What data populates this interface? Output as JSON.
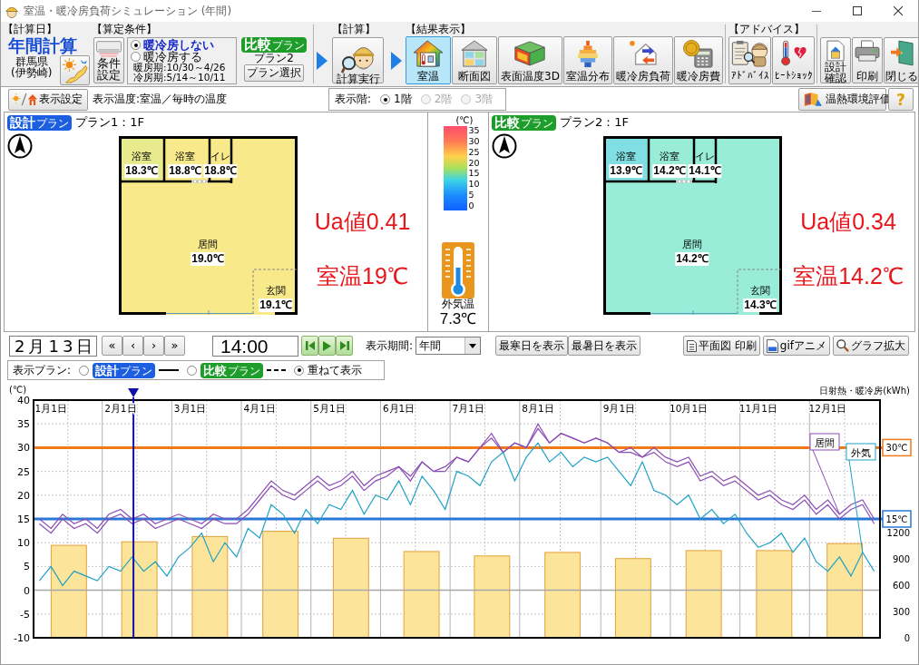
{
  "window": {
    "title": "室温・暖冷房負荷シミュレーション (年間)"
  },
  "toolbar": {
    "calc_date": {
      "heading": "【計算日】",
      "mode": "年間計算",
      "prefecture": "群馬県",
      "city": "(伊勢崎)"
    },
    "conditions": {
      "heading": "【算定条件】",
      "settings_button": "条件設定",
      "hvac_options": [
        {
          "label": "暖冷房しない",
          "selected": true
        },
        {
          "label": "暖冷房する",
          "selected": false
        }
      ],
      "heating_period": "暖房期:10/30～4/26",
      "cooling_period": "冷房期:5/14～10/11",
      "compare_badge": {
        "text": "比較",
        "suffix": "プラン",
        "color": "#1e9d2b"
      },
      "compare_plan": "プラン2",
      "plan_select_button": "プラン選択"
    },
    "calc": {
      "heading": "【計算】",
      "button": "計算実行"
    },
    "results": {
      "heading": "【結果表示】",
      "buttons": [
        {
          "kind": "room-temp",
          "label": "室温",
          "selected": true
        },
        {
          "kind": "section",
          "label": "断面図",
          "selected": false
        },
        {
          "kind": "surface-3d",
          "label": "表面温度3D",
          "selected": false
        },
        {
          "kind": "distribution",
          "label": "室温分布",
          "selected": false
        },
        {
          "kind": "load",
          "label": "暖冷房負荷",
          "selected": false
        },
        {
          "kind": "cost",
          "label": "暖冷房費",
          "selected": false
        }
      ]
    },
    "advice": {
      "heading": "【アドバイス】",
      "buttons": [
        {
          "kind": "advice",
          "label": "ｱﾄﾞﾊﾞｲｽ"
        },
        {
          "kind": "heat-shock",
          "label": "ﾋｰﾄｼｮｯｸ"
        }
      ]
    },
    "tools": [
      {
        "kind": "design-check",
        "label": "設計確認"
      },
      {
        "kind": "print",
        "label": "印刷"
      },
      {
        "kind": "close",
        "label": "閉じる"
      }
    ]
  },
  "display_bar": {
    "settings_button": "表示設定",
    "display_temp": "表示温度:室温／毎時の温度",
    "floor_label": "表示階:",
    "floors": [
      {
        "label": "1階",
        "selected": true,
        "disabled": false
      },
      {
        "label": "2階",
        "selected": false,
        "disabled": true
      },
      {
        "label": "3階",
        "selected": false,
        "disabled": true
      }
    ],
    "evaluation_button": "温熱環境評価",
    "help_button": "?"
  },
  "plans": [
    {
      "badge": {
        "text": "設計",
        "suffix": "プラン",
        "color": "#1b5ee0"
      },
      "title": "プラン1：1F",
      "rooms": [
        {
          "name": "浴室",
          "temp": "18.3℃",
          "color": "#e8ea8e"
        },
        {
          "name": "浴室",
          "temp": "18.8℃",
          "color": "#f8e98b"
        },
        {
          "name": "イレ",
          "temp": "18.8℃",
          "color": "#f8e98b"
        },
        {
          "name": "居間",
          "temp": "19.0℃",
          "color": "#f8e98b"
        },
        {
          "name": "玄関",
          "temp": "19.1℃",
          "color": "#f8e98b"
        }
      ],
      "ua": "Ua値0.41",
      "room_temp": "室温19℃"
    },
    {
      "badge": {
        "text": "比較",
        "suffix": "プラン",
        "color": "#1e9d2b"
      },
      "title": "プラン2：1F",
      "rooms": [
        {
          "name": "浴室",
          "temp": "13.9℃",
          "color": "#80dfe2"
        },
        {
          "name": "浴室",
          "temp": "14.2℃",
          "color": "#99edd8"
        },
        {
          "name": "イレ",
          "temp": "14.1℃",
          "color": "#99edd8"
        },
        {
          "name": "居間",
          "temp": "14.2℃",
          "color": "#99edd8"
        },
        {
          "name": "玄関",
          "temp": "14.3℃",
          "color": "#99edd8"
        }
      ],
      "ua": "Ua値0.34",
      "room_temp": "室温14.2℃"
    }
  ],
  "scale": {
    "unit": "(℃)",
    "ticks": [
      "35",
      "30",
      "25",
      "20",
      "15",
      "10",
      "5",
      "0"
    ],
    "outdoor_label": "外気温",
    "outdoor_temp": "7.3℃"
  },
  "playback": {
    "date": "2月13日",
    "nav_buttons": [
      "«",
      "‹",
      "›",
      "»"
    ],
    "time": "14:00",
    "period_label": "表示期間:",
    "period": "年間",
    "coldest_button": "最寒日を表示",
    "hottest_button": "最暑日を表示",
    "floor_print_button": "平面図 印刷",
    "gif_button": "gifアニメ",
    "zoom_button": "グラフ拡大"
  },
  "plan_view": {
    "label": "表示プラン:",
    "options": [
      {
        "kind": "design",
        "badge": {
          "text": "設計",
          "suffix": "プラン",
          "color": "#1b5ee0"
        },
        "selected": false
      },
      {
        "kind": "compare",
        "badge": {
          "text": "比較",
          "suffix": "プラン",
          "color": "#1e9d2b"
        },
        "selected": false
      },
      {
        "kind": "overlay",
        "label": "重ねて表示",
        "selected": true
      }
    ]
  },
  "graph": {
    "date_cursor": {
      "level": 0.118
    },
    "temperature": {
      "chart_data": {
        "type": "line",
        "ylabel": "(℃)",
        "ylim": [
          -10,
          40
        ],
        "categories": [
          null,
          "1月1日",
          null,
          null,
          null,
          null,
          null,
          "2月1日",
          null,
          null,
          null,
          null,
          null,
          "3月1日",
          null,
          null,
          null,
          null,
          null,
          "4月1日",
          null,
          null,
          null,
          null,
          null,
          "5月1日",
          null,
          null,
          null,
          null,
          null,
          "6月1日",
          null,
          null,
          null,
          null,
          null,
          "7月1日",
          null,
          null,
          null,
          null,
          null,
          "8月1日",
          null,
          null,
          null,
          null,
          null,
          null,
          "9月1日",
          null,
          null,
          null,
          null,
          null,
          "10月1日",
          null,
          null,
          null,
          null,
          null,
          "11月1日",
          null,
          null,
          null,
          null,
          null,
          "12月1日",
          null,
          null,
          null,
          null
        ],
        "yticks": [
          -10,
          -5,
          0,
          5,
          10,
          15,
          20,
          25,
          30,
          35,
          40
        ],
        "series": [
          {
            "name": "居間",
            "color": "#8c4db5",
            "values": [
              15,
              13,
              16,
              14,
              15,
              13,
              16,
              17,
              15,
              16,
              14,
              15,
              16,
              15,
              14,
              16,
              15,
              15,
              17,
              20,
              23,
              21,
              20,
              22,
              24,
              22,
              23,
              25,
              22,
              24,
              25,
              26,
              24,
              27,
              25,
              26,
              28,
              27,
              30,
              32,
              29,
              31,
              30,
              34,
              31,
              33,
              32,
              31,
              32,
              31,
              29,
              30,
              28,
              30,
              28,
              27,
              28,
              24,
              25,
              23,
              24,
              22,
              20,
              21,
              19,
              18,
              20,
              17,
              19,
              16,
              18,
              19,
              15
            ]
          },
          {
            "color": "#8c4db5",
            "values": [
              14,
              12,
              15,
              13,
              14,
              12,
              15,
              16,
              14,
              15,
              13,
              14,
              15,
              14,
              13,
              15,
              14,
              14,
              16,
              19,
              22,
              20,
              19,
              21,
              23,
              21,
              22,
              24,
              21,
              23,
              24,
              26,
              23,
              27,
              25,
              25,
              28,
              27,
              30,
              33,
              29,
              31,
              30,
              35,
              31,
              33,
              32,
              31,
              32,
              31,
              29,
              29,
              28,
              29,
              27,
              26,
              27,
              23,
              24,
              22,
              23,
              21,
              19,
              20,
              18,
              17,
              19,
              16,
              18,
              15,
              17,
              18,
              14
            ]
          },
          {
            "name": "外気",
            "color": "#1ea2c6",
            "values": [
              2,
              5,
              1,
              4,
              3,
              2,
              5,
              4,
              7,
              4,
              6,
              3,
              7,
              9,
              12,
              6,
              10,
              7,
              13,
              11,
              18,
              16,
              12,
              17,
              14,
              18,
              17,
              21,
              16,
              20,
              19,
              23,
              18,
              24,
              21,
              17,
              25,
              24,
              22,
              27,
              29,
              23,
              28,
              31,
              27,
              29,
              26,
              28,
              27,
              28,
              25,
              22,
              27,
              21,
              20,
              18,
              20,
              15,
              17,
              14,
              16,
              12,
              9,
              10,
              12,
              8,
              11,
              6,
              4,
              7,
              3,
              8,
              4
            ]
          }
        ],
        "ref_lines": [
          {
            "axis": "y",
            "value": 30,
            "label": "30℃",
            "color": "#f07a1a"
          },
          {
            "axis": "y",
            "value": 15,
            "label": "15℃",
            "color": "#2a78d6"
          },
          {
            "axis": "y",
            "value": 0,
            "color": "#a8a8a8"
          }
        ]
      }
    },
    "load": {
      "chart_data": {
        "type": "bar",
        "ylabel": "日射熱・暖冷房(kWh)",
        "grid": true,
        "categories": [
          null,
          null,
          null,
          null,
          null,
          null,
          null,
          null,
          null,
          null,
          null,
          null
        ],
        "ylim": [
          0,
          2700
        ],
        "yticks": [
          0,
          300,
          600,
          900,
          1200
        ],
        "series": [
          {
            "color": "#fde49b",
            "values": [
              1050,
              1090,
              1150,
              1210,
              1130,
              980,
              930,
              970,
              900,
              990,
              990,
              1070
            ]
          }
        ]
      }
    }
  }
}
